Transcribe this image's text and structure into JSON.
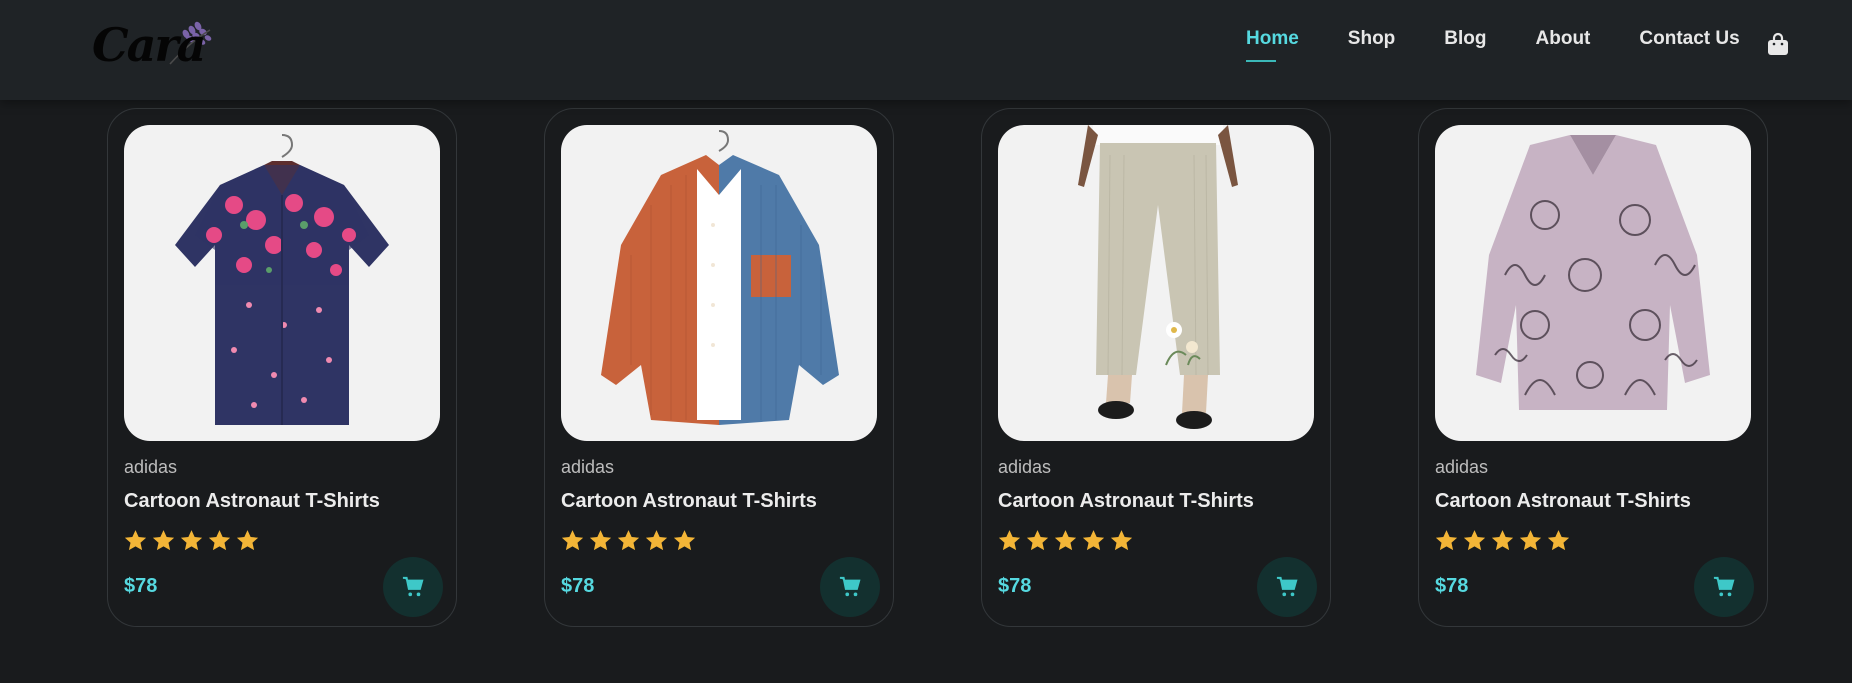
{
  "brand": {
    "logo_text": "Cara"
  },
  "nav": {
    "items": [
      {
        "label": "Home",
        "active": true
      },
      {
        "label": "Shop",
        "active": false
      },
      {
        "label": "Blog",
        "active": false
      },
      {
        "label": "About",
        "active": false
      },
      {
        "label": "Contact Us",
        "active": false
      }
    ],
    "cart_icon": "shopping-bag-icon"
  },
  "products": [
    {
      "brand": "adidas",
      "name": "Cartoon Astronaut T-Shirts",
      "rating": 5,
      "price": "$78",
      "image": "floral-navy-shirt"
    },
    {
      "brand": "adidas",
      "name": "Cartoon Astronaut T-Shirts",
      "rating": 5,
      "price": "$78",
      "image": "orange-blue-corduroy-shirt"
    },
    {
      "brand": "adidas",
      "name": "Cartoon Astronaut T-Shirts",
      "rating": 5,
      "price": "$78",
      "image": "linen-floral-pants"
    },
    {
      "brand": "adidas",
      "name": "Cartoon Astronaut T-Shirts",
      "rating": 5,
      "price": "$78",
      "image": "cat-print-blouse"
    }
  ],
  "colors": {
    "accent": "#56d9e0",
    "star": "#f3b537",
    "background": "#191b1d",
    "header": "#1f2326",
    "cart_button": "#13302f"
  }
}
